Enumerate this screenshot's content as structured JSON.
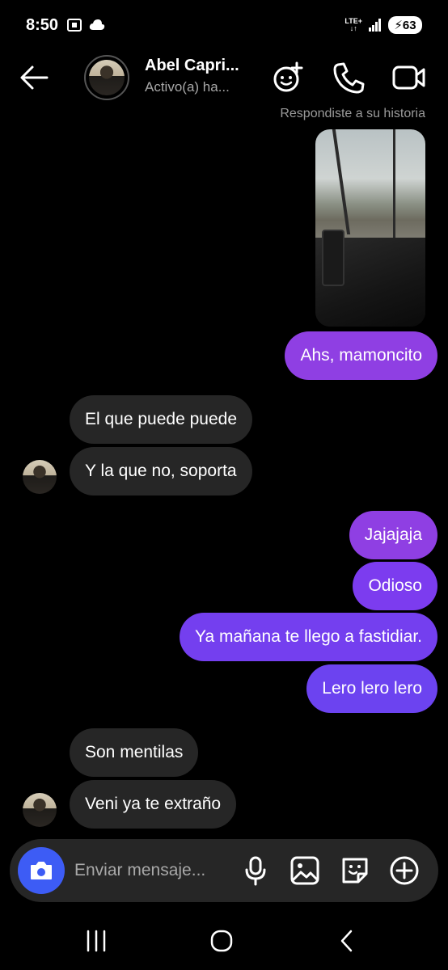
{
  "status_bar": {
    "time": "8:50",
    "network_label": "LTE+",
    "battery": "63"
  },
  "header": {
    "contact_name": "Abel Capri...",
    "contact_status": "Activo(a) ha..."
  },
  "story_reply_note": "Respondiste a su historia",
  "messages": [
    {
      "direction": "out",
      "text": "Ahs, mamoncito"
    },
    {
      "direction": "in",
      "text": "El que puede puede"
    },
    {
      "direction": "in",
      "text": "Y la que no, soporta"
    },
    {
      "direction": "out",
      "text": "Jajajaja"
    },
    {
      "direction": "out",
      "text": "Odioso"
    },
    {
      "direction": "out",
      "text": "Ya mañana te llego a fastidiar."
    },
    {
      "direction": "out",
      "text": "Lero lero lero"
    },
    {
      "direction": "in",
      "text": "Son mentilas"
    },
    {
      "direction": "in",
      "text": "Veni ya te extraño"
    }
  ],
  "composer": {
    "placeholder": "Enviar mensaje..."
  },
  "colors": {
    "outgoing_bubble": "#7a3df0",
    "incoming_bubble": "#262626",
    "camera_button": "#3d5cf5",
    "background": "#000000"
  }
}
